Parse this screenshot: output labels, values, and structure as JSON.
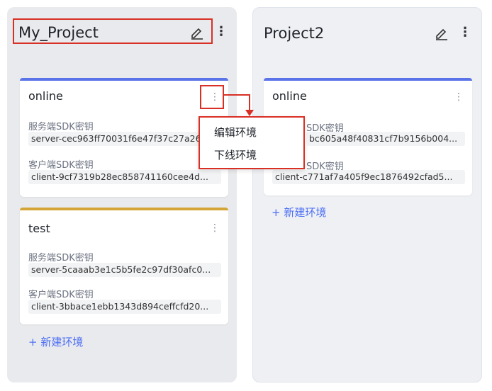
{
  "columns": [
    {
      "title": "My_Project",
      "add_env": "+ 新建环境",
      "envs": [
        {
          "name": "online",
          "color": "#5b73e8",
          "server_label": "服务端SDK密钥",
          "server_key": "server-cec963ff70031f6e47f37c27a26",
          "client_label": "客户端SDK密钥",
          "client_key": "client-9cf7319b28ec858741160cee4d..."
        },
        {
          "name": "test",
          "color": "#d4a437",
          "server_label": "服务端SDK密钥",
          "server_key": "server-5caaab3e1c5b5fe2c97df30afc0...",
          "client_label": "客户端SDK密钥",
          "client_key": "client-3bbace1ebb1343d894ceffcfd20..."
        }
      ]
    },
    {
      "title": "Project2",
      "add_env": "+ 新建环境",
      "envs": [
        {
          "name": "online",
          "color": "#5b73e8",
          "server_label": "SDK密钥",
          "server_key": "bc605a48f40831cf7b9156b004...",
          "client_label": "SDK密钥",
          "client_key": "client-c771af7a405f9ec1876492cfad5..."
        }
      ]
    }
  ],
  "dropdown": {
    "items": [
      "编辑环境",
      "下线环境"
    ]
  },
  "icons": {
    "edit": "edit-icon",
    "more": "more-vertical-icon",
    "card_more": "card-more-icon"
  },
  "accent_color": "#d93025"
}
